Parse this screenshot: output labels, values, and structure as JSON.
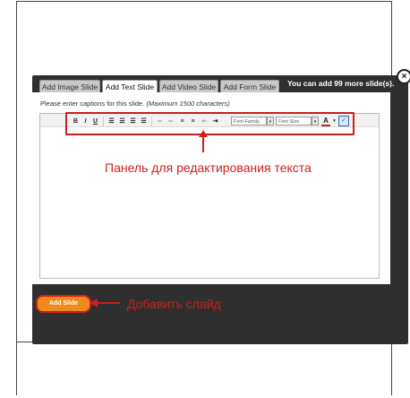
{
  "dialog": {
    "close_icon": "close-icon",
    "close_glyph": "×",
    "slides_left": "You can add 99 more slide(s).",
    "tabs": [
      {
        "label": "Add Image Slide",
        "active": false
      },
      {
        "label": "Add Text Slide",
        "active": true
      },
      {
        "label": "Add Video Slide",
        "active": false
      },
      {
        "label": "Add Form Slide",
        "active": false
      }
    ],
    "caption_prompt": "Please enter captions for this slide.",
    "caption_limit": "(Maximum 1500 characters)",
    "toolbar": {
      "bold": "B",
      "italic": "I",
      "underline": "U",
      "font_family": "Font Family",
      "font_size": "Font Size",
      "font_color": "A",
      "dropdown_glyph": "▾",
      "icons": [
        "align-left-icon",
        "align-center-icon",
        "align-right-icon",
        "align-justify-icon",
        "link-icon",
        "unlink-icon",
        "bullet-list-icon",
        "numbered-list-icon",
        "outdent-icon",
        "indent-icon",
        "spellcheck-icon"
      ]
    },
    "add_slide_label": "Add Slide"
  },
  "annotations": {
    "toolbar_note": "Панель для редактирования текста",
    "add_note": "Добавить слайд",
    "color": "#cc1f1f"
  }
}
